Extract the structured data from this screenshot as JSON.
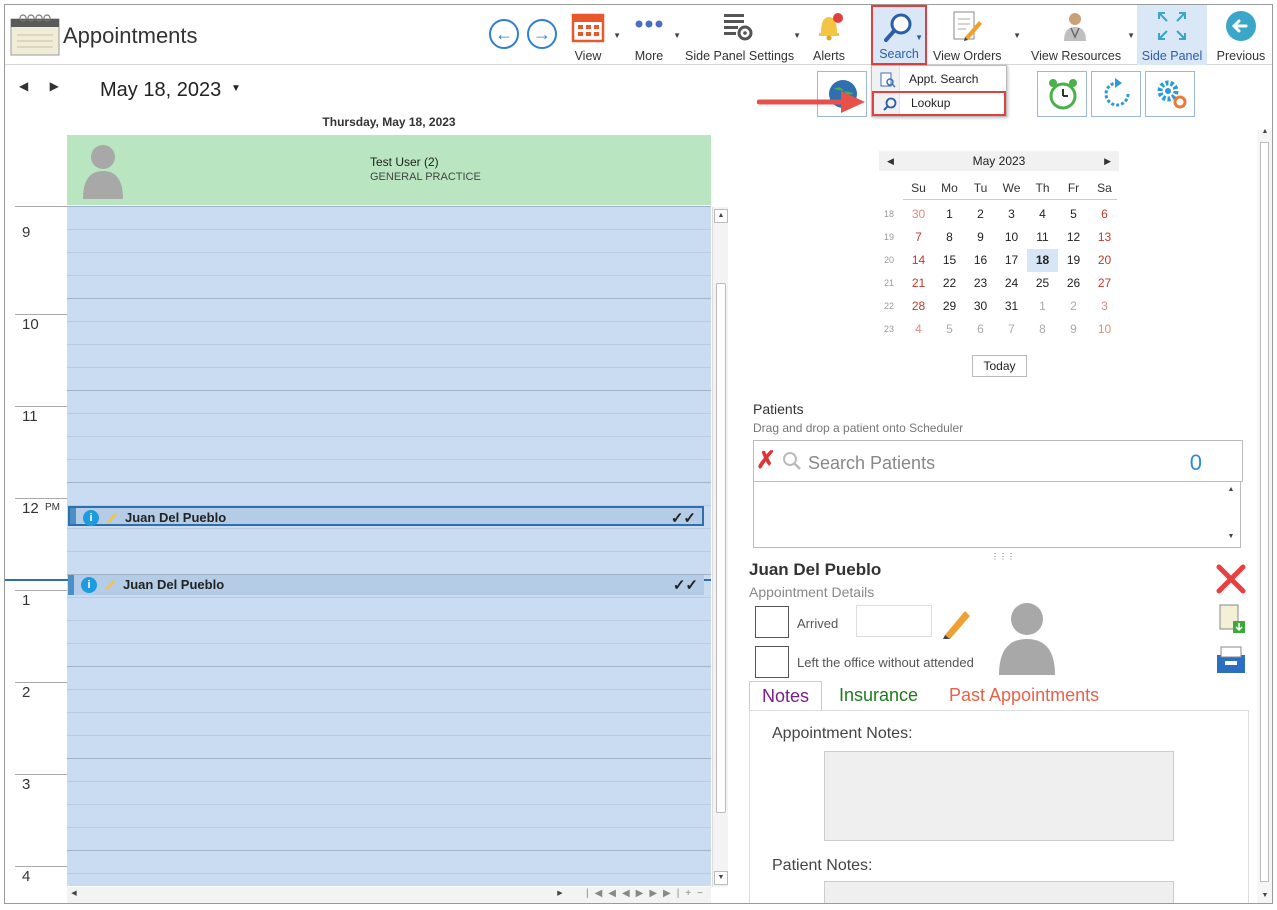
{
  "app": {
    "title": "Appointments"
  },
  "toolbar": {
    "view": "View",
    "more": "More",
    "side_panel_settings": "Side Panel Settings",
    "alerts": "Alerts",
    "search": "Search",
    "view_orders": "View Orders",
    "view_resources": "View Resources",
    "side_panel": "Side Panel",
    "previous": "Previous"
  },
  "search_menu": {
    "items": [
      {
        "label": "Appt. Search",
        "icon": "document-search-icon"
      },
      {
        "label": "Lookup",
        "icon": "magnifier-icon"
      }
    ]
  },
  "scheduler": {
    "date": "May 18, 2023",
    "day_header": "Thursday, May 18, 2023",
    "resource": {
      "name": "Test User (2)",
      "department": "GENERAL PRACTICE"
    },
    "hours": [
      "9",
      "10",
      "11",
      "12",
      "1",
      "2",
      "3",
      "4"
    ],
    "pm_marker": "PM",
    "appointments": [
      {
        "name": "Juan Del Pueblo",
        "status": "✓✓"
      },
      {
        "name": "Juan Del Pueblo",
        "status": "✓✓"
      }
    ]
  },
  "mini_calendar": {
    "month": "May 2023",
    "days_of_week": [
      "Su",
      "Mo",
      "Tu",
      "We",
      "Th",
      "Fr",
      "Sa"
    ],
    "weeks": [
      {
        "wk": "18",
        "days": [
          "30",
          "1",
          "2",
          "3",
          "4",
          "5",
          "6"
        ]
      },
      {
        "wk": "19",
        "days": [
          "7",
          "8",
          "9",
          "10",
          "11",
          "12",
          "13"
        ]
      },
      {
        "wk": "20",
        "days": [
          "14",
          "15",
          "16",
          "17",
          "18",
          "19",
          "20"
        ]
      },
      {
        "wk": "21",
        "days": [
          "21",
          "22",
          "23",
          "24",
          "25",
          "26",
          "27"
        ]
      },
      {
        "wk": "22",
        "days": [
          "28",
          "29",
          "30",
          "31",
          "1",
          "2",
          "3"
        ]
      },
      {
        "wk": "23",
        "days": [
          "4",
          "5",
          "6",
          "7",
          "8",
          "9",
          "10"
        ]
      }
    ],
    "selected": "18",
    "today_button": "Today"
  },
  "patients": {
    "title": "Patients",
    "subtitle": "Drag and drop a patient onto Scheduler",
    "search_placeholder": "Search Patients",
    "count": "0"
  },
  "appointment_details": {
    "patient_name": "Juan Del Pueblo",
    "subtitle": "Appointment Details",
    "arrived_label": "Arrived",
    "left_label": "Left the office without attended",
    "tabs": [
      {
        "label": "Notes",
        "color": "#7a1e8a"
      },
      {
        "label": "Insurance",
        "color": "#1f7a1f"
      },
      {
        "label": "Past Appointments",
        "color": "#e8624a"
      }
    ],
    "appointment_notes_label": "Appointment Notes:",
    "patient_notes_label": "Patient Notes:"
  },
  "colors": {
    "accent": "#2f7ed8",
    "highlight": "#e04040",
    "resource_bg": "#b9e6c0",
    "grid_bg": "#c9dcf1"
  }
}
